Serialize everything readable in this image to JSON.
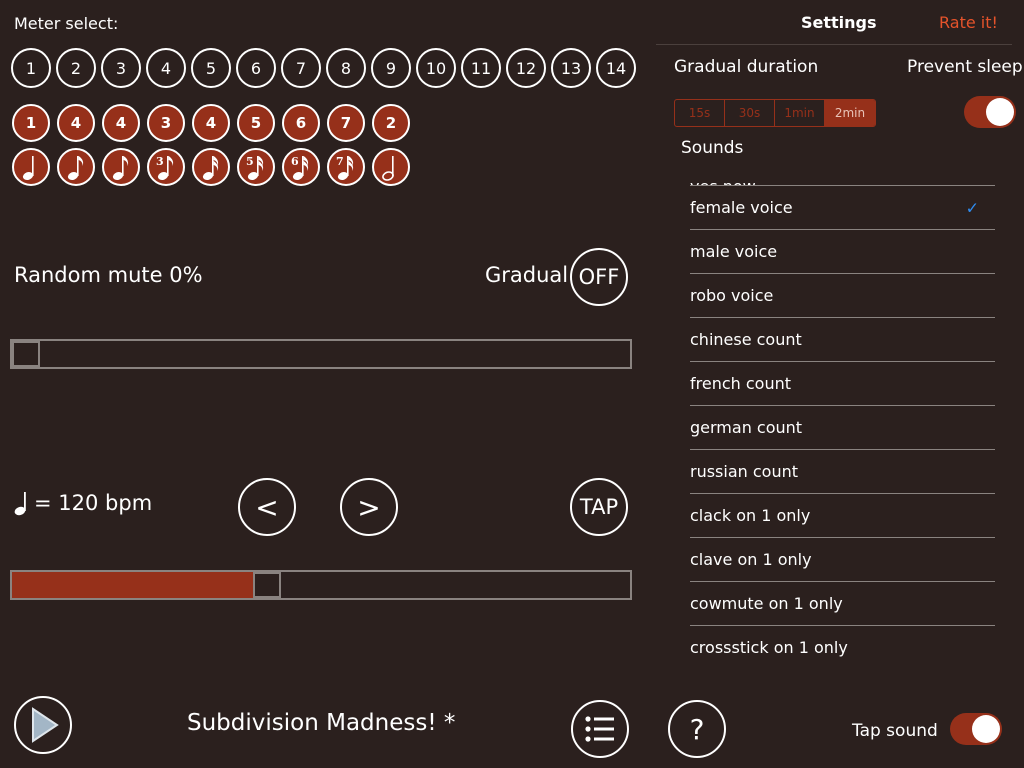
{
  "meter": {
    "label": "Meter select:",
    "options": [
      "1",
      "2",
      "3",
      "4",
      "5",
      "6",
      "7",
      "8",
      "9",
      "10",
      "11",
      "12",
      "13",
      "14"
    ]
  },
  "pattern": {
    "beats": [
      "1",
      "4",
      "4",
      "3",
      "4",
      "5",
      "6",
      "7",
      "2"
    ],
    "notes": [
      {
        "icon": "quarter-note-icon",
        "tuplet": ""
      },
      {
        "icon": "eighth-note-icon",
        "tuplet": ""
      },
      {
        "icon": "eighth-note-icon",
        "tuplet": ""
      },
      {
        "icon": "triplet-eighth-note-icon",
        "tuplet": "3"
      },
      {
        "icon": "sixteenth-note-icon",
        "tuplet": ""
      },
      {
        "icon": "quintuplet-sixteenth-note-icon",
        "tuplet": "5"
      },
      {
        "icon": "sextuplet-sixteenth-note-icon",
        "tuplet": "6"
      },
      {
        "icon": "septuplet-sixteenth-note-icon",
        "tuplet": "7"
      },
      {
        "icon": "half-note-icon",
        "tuplet": ""
      }
    ]
  },
  "random_mute": {
    "label": "Random mute 0%",
    "value_percent": 0,
    "gradual_label": "Gradual",
    "gradual_state": "OFF"
  },
  "tempo": {
    "note_icon": "quarter-note-icon",
    "label": "= 120 bpm",
    "prev_label": "<",
    "next_label": ">",
    "tap_label": "TAP",
    "slider_fraction": 0.39
  },
  "transport": {
    "play_icon": "play-icon",
    "song_title": "Subdivision Madness! *",
    "list_icon": "list-icon",
    "help_label": "?"
  },
  "settings": {
    "title": "Settings",
    "rate_label": "Rate it!",
    "gradual_duration_label": "Gradual duration",
    "durations": [
      "15s",
      "30s",
      "1min",
      "2min"
    ],
    "selected_duration": "2min",
    "prevent_sleep_label": "Prevent sleep",
    "prevent_sleep_on": true,
    "sounds_label": "Sounds",
    "sounds": [
      {
        "label": "yes now",
        "partial": true
      },
      {
        "label": "female voice",
        "selected": true
      },
      {
        "label": "male voice"
      },
      {
        "label": "robo voice"
      },
      {
        "label": "chinese count"
      },
      {
        "label": "french count"
      },
      {
        "label": "german count"
      },
      {
        "label": "russian count"
      },
      {
        "label": "clack on 1 only"
      },
      {
        "label": "clave on 1 only"
      },
      {
        "label": "cowmute on 1 only"
      },
      {
        "label": "crossstick on 1 only"
      }
    ],
    "check_glyph": "✓",
    "tap_sound_label": "Tap sound",
    "tap_sound_on": true
  },
  "colors": {
    "background": "#2b201e",
    "accent": "#96301a",
    "rate_link": "#e5532b",
    "check": "#2f8cf0"
  }
}
